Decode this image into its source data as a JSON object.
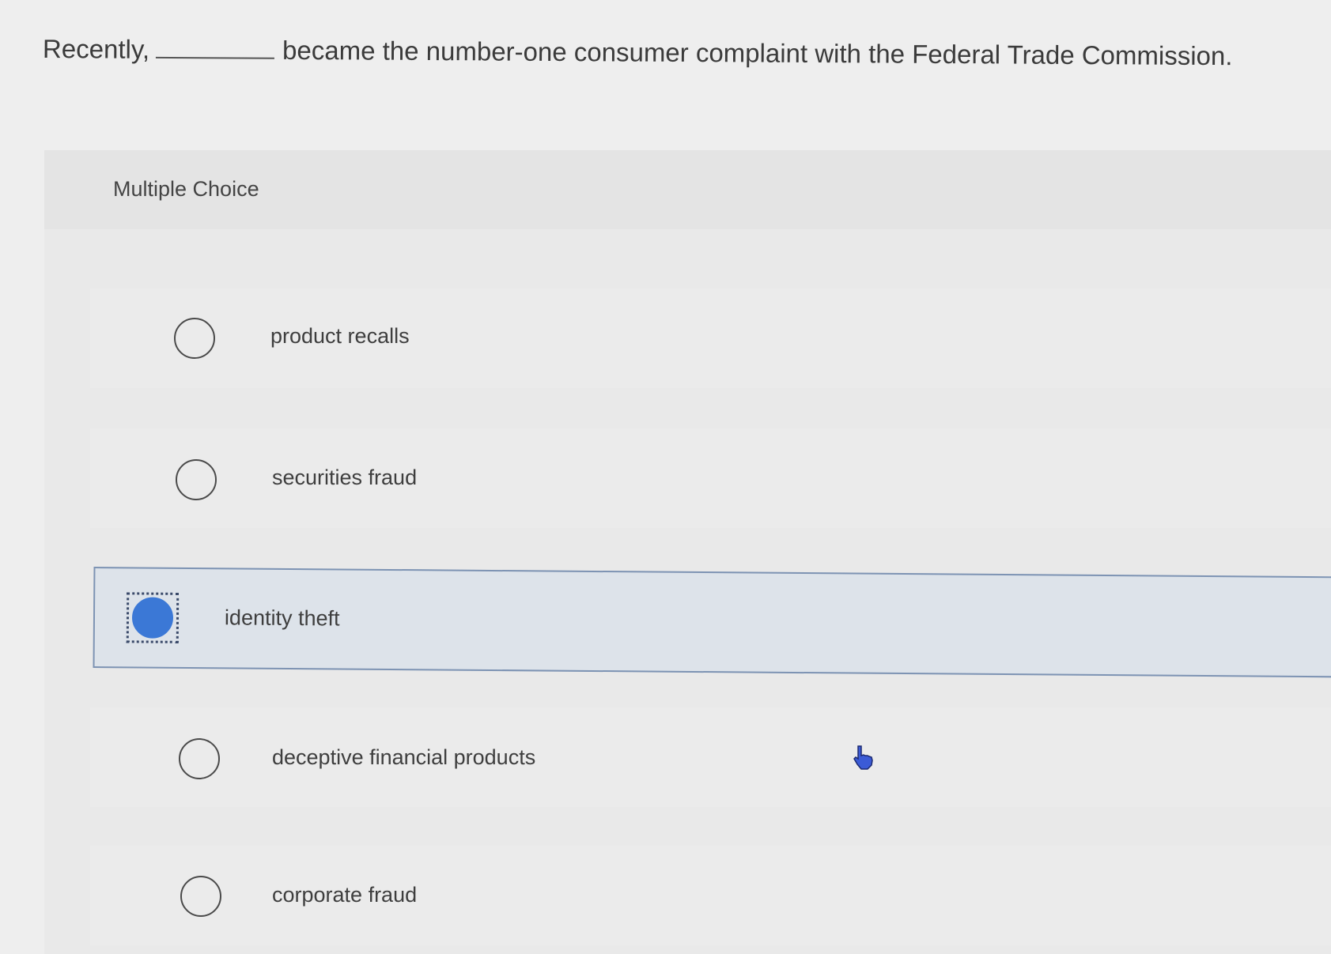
{
  "question": {
    "before_blank": "Recently,",
    "after_blank": "became the number-one consumer complaint with the Federal Trade Commission."
  },
  "section": {
    "label": "Multiple Choice"
  },
  "options": [
    {
      "label": "product recalls",
      "selected": false
    },
    {
      "label": "securities fraud",
      "selected": false
    },
    {
      "label": "identity theft",
      "selected": true
    },
    {
      "label": "deceptive financial products",
      "selected": false
    },
    {
      "label": "corporate fraud",
      "selected": false
    }
  ],
  "colors": {
    "selected_fill": "#3b78d6",
    "selected_row_bg": "#dde3ea",
    "selected_row_border": "#7d93b3"
  },
  "icons": {
    "cursor": "hand-pointer-icon"
  }
}
